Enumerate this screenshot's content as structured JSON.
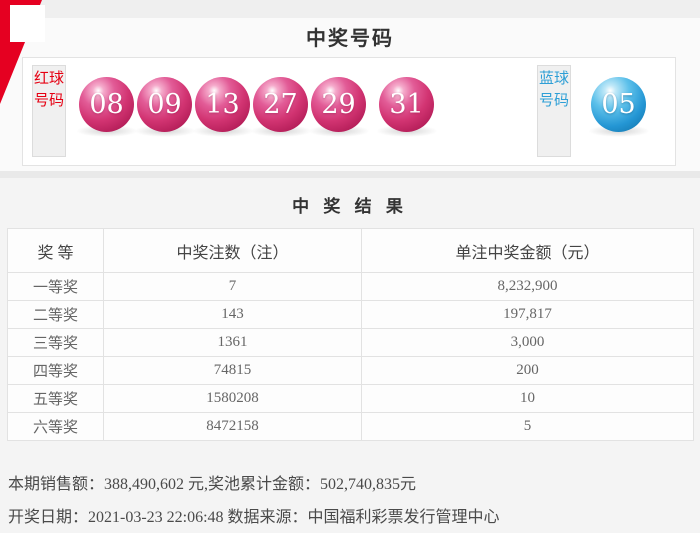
{
  "page": {
    "title": "中奖号码",
    "result_title": "中 奖 结 果"
  },
  "balls": {
    "red_label": "红球号码",
    "blue_label": "蓝球号码",
    "red": [
      "08",
      "09",
      "13",
      "27",
      "29",
      "31"
    ],
    "blue": "05",
    "red_ball_color": "#d23472",
    "blue_ball_color": "#2496d4",
    "red_label_color": "#e60012",
    "blue_label_color": "#2e9fd6"
  },
  "table": {
    "headers": [
      "奖 等",
      "中奖注数（注）",
      "单注中奖金额（元）"
    ],
    "rows": [
      {
        "level": "一等奖",
        "count": "7",
        "amount": "8,232,900"
      },
      {
        "level": "二等奖",
        "count": "143",
        "amount": "197,817"
      },
      {
        "level": "三等奖",
        "count": "1361",
        "amount": "3,000"
      },
      {
        "level": "四等奖",
        "count": "74815",
        "amount": "200"
      },
      {
        "level": "五等奖",
        "count": "1580208",
        "amount": "10"
      },
      {
        "level": "六等奖",
        "count": "8472158",
        "amount": "5"
      }
    ]
  },
  "footer": {
    "sales_line": "本期销售额：388,490,602 元,奖池累计金额：502,740,835元",
    "draw_line": "开奖日期：2021-03-23 22:06:48 数据来源：中国福利彩票发行管理中心"
  },
  "decor": {
    "ribbon_color": "#e50021"
  }
}
